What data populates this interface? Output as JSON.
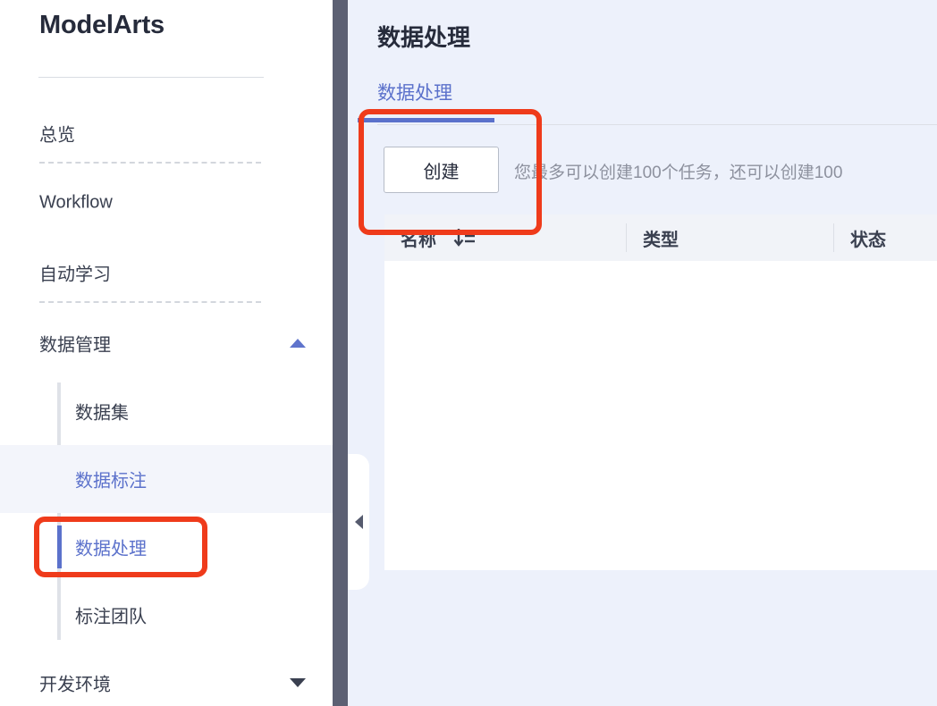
{
  "sidebar": {
    "brand": "ModelArts",
    "top_items": [
      {
        "label": "总览",
        "icon": "none",
        "caret": "none"
      },
      {
        "label": "Workflow",
        "icon": "none",
        "caret": "none"
      },
      {
        "label": "自动学习",
        "icon": "none",
        "caret": "none"
      },
      {
        "label": "数据管理",
        "icon": "chevron-up-icon",
        "caret": "up"
      }
    ],
    "sub_items": [
      {
        "label": "数据集",
        "state": "normal"
      },
      {
        "label": "数据标注",
        "state": "hover"
      },
      {
        "label": "数据处理",
        "state": "selected"
      },
      {
        "label": "标注团队",
        "state": "normal"
      }
    ],
    "bottom_item": {
      "label": "开发环境",
      "caret": "down"
    }
  },
  "main": {
    "page_title": "数据处理",
    "tabs": [
      {
        "label": "数据处理",
        "active": true
      }
    ],
    "create_button_label": "创建",
    "quota_text": "您最多可以创建100个任务，还可以创建100",
    "table": {
      "columns": [
        {
          "label": "名称",
          "sort_icon": "sort-descending-icon"
        },
        {
          "label": "类型",
          "sort_icon": "none"
        },
        {
          "label": "状态",
          "sort_icon": "none"
        }
      ],
      "rows": []
    }
  },
  "controls": {
    "collapse_handle_icon": "chevron-left-icon"
  },
  "annotations": {
    "boxes": [
      {
        "target": "sidebar-item-数据处理",
        "color": "#ef3b1b"
      },
      {
        "target": "create-button-region",
        "color": "#ef3b1b"
      }
    ]
  },
  "colors": {
    "accent_blue": "#5b71cb",
    "annotation_red": "#ef3b1b",
    "panel_bg": "#edf1fb",
    "dark_strip": "#5c6073",
    "title_text": "#262b3b",
    "muted_text": "#8d919e"
  }
}
